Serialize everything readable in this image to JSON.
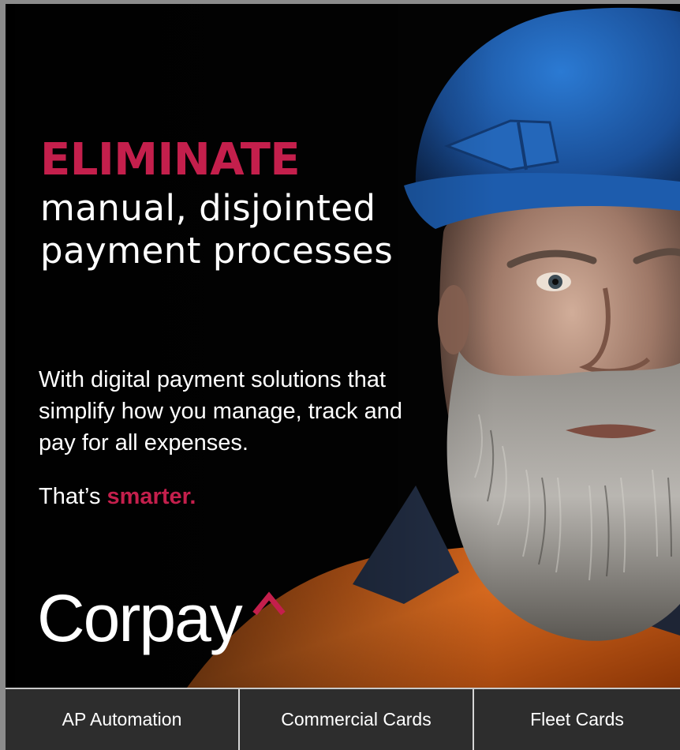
{
  "ad": {
    "headline_strong": "ELIMINATE",
    "headline_rest": "manual, disjointed payment processes",
    "body_copy": "With digital payment solutions that simplify how you manage, track and pay for all expenses.",
    "tagline_prefix": "That’s ",
    "tagline_accent": "smarter.",
    "brand": "Corpay",
    "photo": "bearded-worker-blue-hard-hat-orange-shirt",
    "colors": {
      "accent": "#c41f4c",
      "background": "#030303",
      "text": "#ffffff",
      "hard_hat": "#1f63b8",
      "shirt": "#d76218"
    }
  },
  "nav": {
    "items": [
      {
        "label": "AP Automation"
      },
      {
        "label": "Commercial Cards"
      },
      {
        "label": "Fleet Cards"
      }
    ],
    "colors": {
      "background": "#2d2d2d",
      "divider": "#d6d6d6"
    }
  }
}
